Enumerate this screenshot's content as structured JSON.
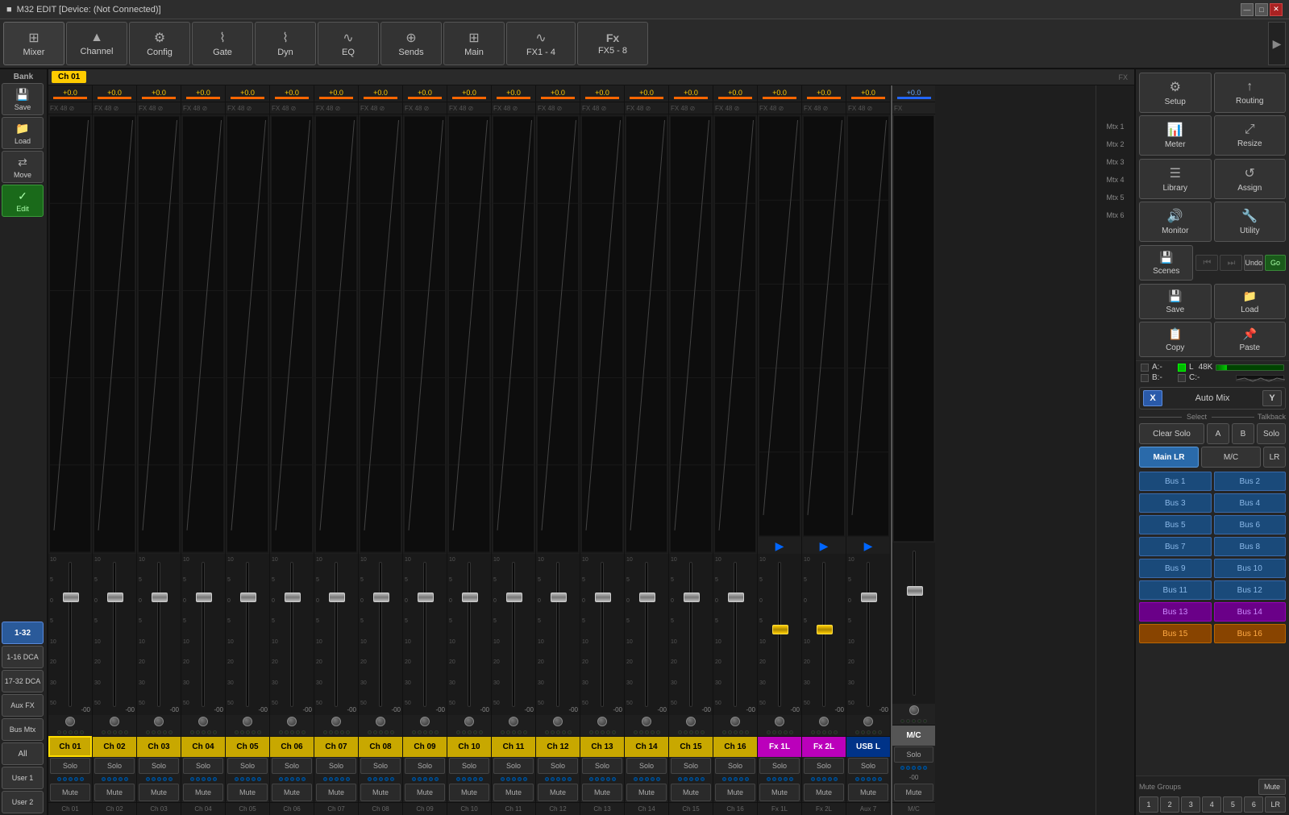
{
  "titleBar": {
    "icon": "■",
    "title": "M32 EDIT [Device: (Not Connected)]",
    "minimize": "—",
    "maximize": "□",
    "close": "✕"
  },
  "topNav": {
    "buttons": [
      {
        "id": "mixer",
        "icon": "⊞",
        "label": "Mixer",
        "active": true
      },
      {
        "id": "channel",
        "icon": "↑",
        "label": "Channel"
      },
      {
        "id": "config",
        "icon": "⚙",
        "label": "Config"
      },
      {
        "id": "gate",
        "icon": "◺",
        "label": "Gate"
      },
      {
        "id": "dyn",
        "icon": "◺",
        "label": "Dyn"
      },
      {
        "id": "eq",
        "icon": "~",
        "label": "EQ"
      },
      {
        "id": "sends",
        "icon": "⊕",
        "label": "Sends"
      },
      {
        "id": "main",
        "icon": "⊞",
        "label": "Main"
      },
      {
        "id": "fx1",
        "icon": "~",
        "label": "FX1 - 4"
      },
      {
        "id": "fx5",
        "icon": "Fx",
        "label": "FX5 - 8"
      }
    ],
    "arrow": "▶"
  },
  "rightPanel": {
    "setup": "Setup",
    "routing": "Routing",
    "meter": "Meter",
    "resize": "Resize",
    "library": "Library",
    "assign": "Assign",
    "monitor": "Monitor",
    "utility": "Utility",
    "scenes": "Scenes",
    "save": "Save",
    "load": "Load",
    "copy": "Copy",
    "paste": "Paste",
    "undo": "Undo",
    "go": "Go",
    "meterA": "A:-",
    "meterL": "L",
    "meterHz": "48K",
    "meterB": "B:-",
    "meterC": "C:-",
    "automixX": "X",
    "automixLabel": "Auto Mix",
    "automixY": "Y",
    "selectLabel": "Select",
    "talkbackLabel": "Talkback",
    "clearSolo": "Clear Solo",
    "talkbackA": "A",
    "talkbackB": "B",
    "solo": "Solo",
    "mainLR": "Main LR",
    "mc": "M/C",
    "lr": "LR",
    "buses": [
      "Bus 1",
      "Bus 2",
      "Bus 3",
      "Bus 4",
      "Bus 5",
      "Bus 6",
      "Bus 7",
      "Bus 8",
      "Bus 9",
      "Bus 10",
      "Bus 11",
      "Bus 12",
      "Bus 13",
      "Bus 14",
      "Bus 15",
      "Bus 16"
    ],
    "muteGroupsLabel": "Mute Groups",
    "muteGroups": [
      "1",
      "2",
      "3",
      "4",
      "5",
      "6"
    ],
    "muteBtnLabel": "Mute",
    "lrBtnLabel": "LR"
  },
  "leftBank": {
    "bankLabel": "Bank",
    "saveLabel": "Save",
    "loadLabel": "Load",
    "moveLabel": "Move",
    "editLabel": "Edit",
    "range132": "1-32",
    "range116dca": "1-16 DCA",
    "range1732dca": "17-32 DCA",
    "auxFx": "Aux FX",
    "busMtx": "Bus Mtx",
    "all": "All",
    "user1": "User 1",
    "user2": "User 2"
  },
  "channels": [
    {
      "id": "ch01",
      "name": "Ch 01",
      "db": "+0.0",
      "color": "yellow",
      "solo": "Solo",
      "mute": "Mute",
      "bottomLabel": "Ch 01",
      "faderPos": 78
    },
    {
      "id": "ch02",
      "name": "Ch 02",
      "db": "+0.0",
      "color": "yellow",
      "solo": "Solo",
      "mute": "Mute",
      "bottomLabel": "Ch 02",
      "faderPos": 78
    },
    {
      "id": "ch03",
      "name": "Ch 03",
      "db": "+0.0",
      "color": "yellow",
      "solo": "Solo",
      "mute": "Mute",
      "bottomLabel": "Ch 03",
      "faderPos": 78
    },
    {
      "id": "ch04",
      "name": "Ch 04",
      "db": "+0.0",
      "color": "yellow",
      "solo": "Solo",
      "mute": "Mute",
      "bottomLabel": "Ch 04",
      "faderPos": 78
    },
    {
      "id": "ch05",
      "name": "Ch 05",
      "db": "+0.0",
      "color": "yellow",
      "solo": "Solo",
      "mute": "Mute",
      "bottomLabel": "Ch 05",
      "faderPos": 78
    },
    {
      "id": "ch06",
      "name": "Ch 06",
      "db": "+0.0",
      "color": "yellow",
      "solo": "Solo",
      "mute": "Mute",
      "bottomLabel": "Ch 06",
      "faderPos": 78
    },
    {
      "id": "ch07",
      "name": "Ch 07",
      "db": "+0.0",
      "color": "yellow",
      "solo": "Solo",
      "mute": "Mute",
      "bottomLabel": "Ch 07",
      "faderPos": 78
    },
    {
      "id": "ch08",
      "name": "Ch 08",
      "db": "+0.0",
      "color": "yellow",
      "solo": "Solo",
      "mute": "Mute",
      "bottomLabel": "Ch 08",
      "faderPos": 78
    },
    {
      "id": "ch09",
      "name": "Ch 09",
      "db": "+0.0",
      "color": "yellow",
      "solo": "Solo",
      "mute": "Mute",
      "bottomLabel": "Ch 09",
      "faderPos": 78
    },
    {
      "id": "ch10",
      "name": "Ch 10",
      "db": "+0.0",
      "color": "yellow",
      "solo": "Solo",
      "mute": "Mute",
      "bottomLabel": "Ch 10",
      "faderPos": 78
    },
    {
      "id": "ch11",
      "name": "Ch 11",
      "db": "+0.0",
      "color": "yellow",
      "solo": "Solo",
      "mute": "Mute",
      "bottomLabel": "Ch 11",
      "faderPos": 78
    },
    {
      "id": "ch12",
      "name": "Ch 12",
      "db": "+0.0",
      "color": "yellow",
      "solo": "Solo",
      "mute": "Mute",
      "bottomLabel": "Ch 12",
      "faderPos": 78
    },
    {
      "id": "ch13",
      "name": "Ch 13",
      "db": "+0.0",
      "color": "yellow",
      "solo": "Solo",
      "mute": "Mute",
      "bottomLabel": "Ch 13",
      "faderPos": 78
    },
    {
      "id": "ch14",
      "name": "Ch 14",
      "db": "+0.0",
      "color": "yellow",
      "solo": "Solo",
      "mute": "Mute",
      "bottomLabel": "Ch 14",
      "faderPos": 78
    },
    {
      "id": "ch15",
      "name": "Ch 15",
      "db": "+0.0",
      "color": "yellow",
      "solo": "Solo",
      "mute": "Mute",
      "bottomLabel": "Ch 15",
      "faderPos": 78
    },
    {
      "id": "ch16",
      "name": "Ch 16",
      "db": "+0.0",
      "color": "yellow",
      "solo": "Solo",
      "mute": "Mute",
      "bottomLabel": "Ch 16",
      "faderPos": 78
    },
    {
      "id": "fx1l",
      "name": "Fx 1L",
      "db": "+0.0",
      "color": "magenta",
      "solo": "Solo",
      "mute": "Mute",
      "bottomLabel": "Fx 1L",
      "faderPos": 55
    },
    {
      "id": "fx2l",
      "name": "Fx 2L",
      "db": "+0.0",
      "color": "magenta",
      "solo": "Solo",
      "mute": "Mute",
      "bottomLabel": "Fx 2L",
      "faderPos": 55
    },
    {
      "id": "usbl",
      "name": "USB L",
      "db": "+0.0",
      "color": "darkblue",
      "solo": "Solo",
      "mute": "Mute",
      "bottomLabel": "Aux 7",
      "faderPos": 78
    }
  ],
  "masterChannel": {
    "name": "M/C",
    "db": "-00",
    "dbRight": "+0.0",
    "solo": "Solo",
    "mute": "Mute",
    "bottomLabel": "M/C"
  },
  "mtxLabels": [
    "Mtx 1",
    "Mtx 2",
    "Mtx 3",
    "Mtx 4",
    "Mtx 5",
    "Mtx 6"
  ],
  "faderDbLabels": [
    "10",
    "5",
    "0",
    "5",
    "10",
    "20",
    "30",
    "50"
  ],
  "ch01Header": "Ch 01"
}
